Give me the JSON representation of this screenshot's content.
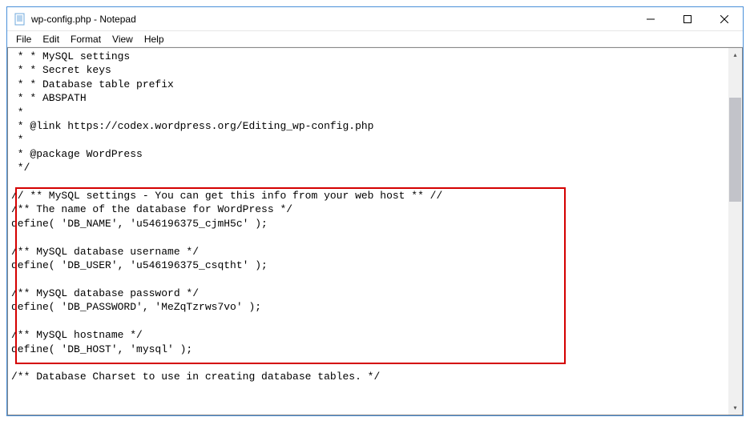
{
  "window": {
    "title": "wp-config.php - Notepad"
  },
  "menu": {
    "file": "File",
    "edit": "Edit",
    "format": "Format",
    "view": "View",
    "help": "Help"
  },
  "lines": {
    "l0": " * * MySQL settings",
    "l1": " * * Secret keys",
    "l2": " * * Database table prefix",
    "l3": " * * ABSPATH",
    "l4": " *",
    "l5": " * @link https://codex.wordpress.org/Editing_wp-config.php",
    "l6": " *",
    "l7": " * @package WordPress",
    "l8": " */",
    "l9": "",
    "l10": "// ** MySQL settings - You can get this info from your web host ** //",
    "l11": "/** The name of the database for WordPress */",
    "l12": "define( 'DB_NAME', 'u546196375_cjmH5c' );",
    "l13": "",
    "l14": "/** MySQL database username */",
    "l15": "define( 'DB_USER', 'u546196375_csqtht' );",
    "l16": "",
    "l17": "/** MySQL database password */",
    "l18": "define( 'DB_PASSWORD', 'MeZqTzrws7vo' );",
    "l19": "",
    "l20": "/** MySQL hostname */",
    "l21": "define( 'DB_HOST', 'mysql' );",
    "l22": "",
    "l23": "/** Database Charset to use in creating database tables. */"
  }
}
